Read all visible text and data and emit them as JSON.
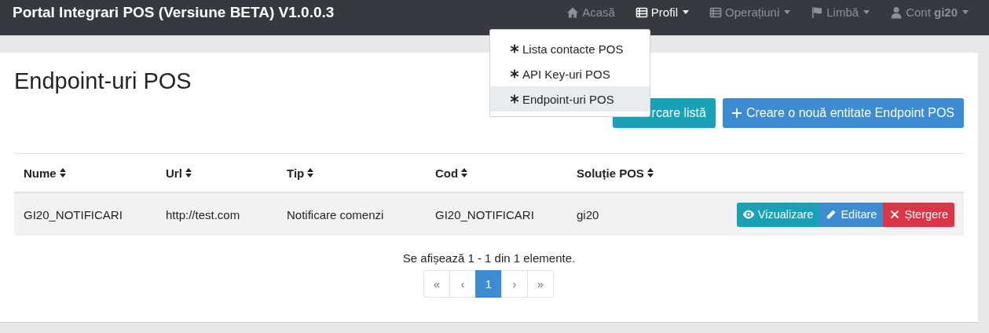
{
  "navbar": {
    "brand": "Portal Integrari POS (Versiune BETA) V1.0.0.3",
    "items": [
      {
        "label": "Acasă",
        "kind": "home",
        "selected": false,
        "dropdown": false
      },
      {
        "label": "Profil",
        "kind": "list",
        "selected": true,
        "dropdown": true
      },
      {
        "label": "Operațiuni",
        "kind": "list",
        "selected": false,
        "dropdown": true
      },
      {
        "label": "Limbă",
        "kind": "flag",
        "selected": false,
        "dropdown": true
      },
      {
        "label": "Cont **gi20**",
        "kind": "user",
        "selected": false,
        "dropdown": true
      }
    ],
    "menu": [
      {
        "label": "Lista contacte POS",
        "selected": false
      },
      {
        "label": "API Key-uri POS",
        "selected": false
      },
      {
        "label": "Endpoint-uri POS",
        "selected": true
      }
    ]
  },
  "page": {
    "title": "Endpoint-uri POS",
    "buttons": [
      {
        "label": "rcare listă",
        "kind": "reload"
      },
      {
        "label": "Creare o nouă entitate Endpoint POS",
        "kind": "create"
      }
    ]
  },
  "table": {
    "columns": [
      "Nume",
      "Url",
      "Tip",
      "Cod",
      "Soluție POS"
    ],
    "rows": [
      {
        "cells": [
          "GI20_NOTIFICARI",
          "http://test.com",
          "Notificare comenzi",
          "GI20_NOTIFICARI",
          "gi20"
        ],
        "actions": [
          {
            "label": "Vizualizare",
            "kind": "view"
          },
          {
            "label": "Editare",
            "kind": "edit"
          },
          {
            "label": "Ștergere",
            "kind": "delete"
          }
        ]
      }
    ]
  },
  "summary": "Se afișează 1 - 1 din 1 elemente.",
  "pagination": [
    {
      "label": "«",
      "selected": false
    },
    {
      "label": "‹",
      "selected": false
    },
    {
      "label": "1",
      "selected": true
    },
    {
      "label": "›",
      "selected": false
    },
    {
      "label": "»",
      "selected": false
    }
  ]
}
